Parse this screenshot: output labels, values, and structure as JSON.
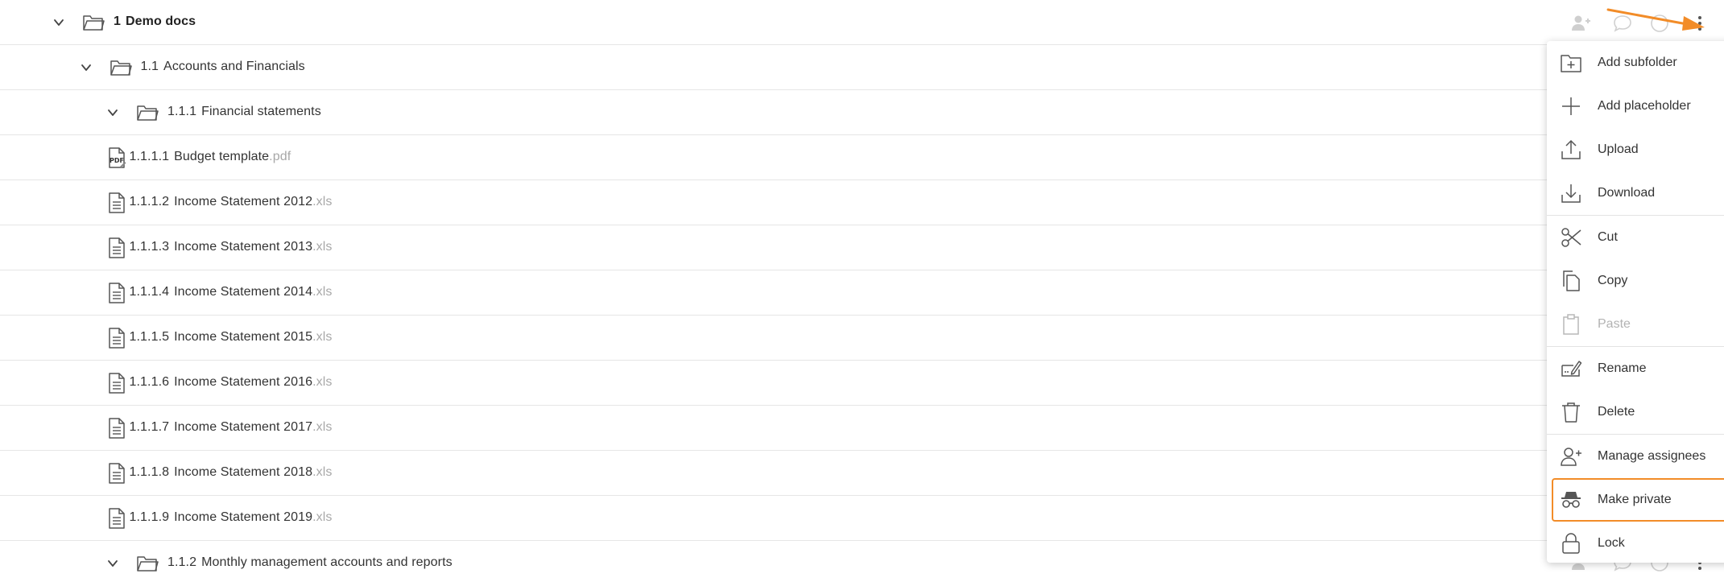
{
  "tree": {
    "rows": [
      {
        "num": "1",
        "name": "Demo docs",
        "ext": "",
        "kind": "folder",
        "bold": true
      },
      {
        "num": "1.1",
        "name": "Accounts and Financials",
        "ext": "",
        "kind": "folder"
      },
      {
        "num": "1.1.1",
        "name": "Financial statements",
        "ext": "",
        "kind": "folder"
      },
      {
        "num": "1.1.1.1",
        "name": "Budget template",
        "ext": ".pdf",
        "kind": "pdf"
      },
      {
        "num": "1.1.1.2",
        "name": "Income Statement 2012",
        "ext": ".xls",
        "kind": "file"
      },
      {
        "num": "1.1.1.3",
        "name": "Income Statement 2013",
        "ext": ".xls",
        "kind": "file"
      },
      {
        "num": "1.1.1.4",
        "name": "Income Statement 2014",
        "ext": ".xls",
        "kind": "file"
      },
      {
        "num": "1.1.1.5",
        "name": "Income Statement 2015",
        "ext": ".xls",
        "kind": "file"
      },
      {
        "num": "1.1.1.6",
        "name": "Income Statement 2016",
        "ext": ".xls",
        "kind": "file"
      },
      {
        "num": "1.1.1.7",
        "name": "Income Statement 2017",
        "ext": ".xls",
        "kind": "file"
      },
      {
        "num": "1.1.1.8",
        "name": "Income Statement 2018",
        "ext": ".xls",
        "kind": "file"
      },
      {
        "num": "1.1.1.9",
        "name": "Income Statement 2019",
        "ext": ".xls",
        "kind": "file"
      },
      {
        "num": "1.1.2",
        "name": "Monthly management accounts and reports",
        "ext": "",
        "kind": "folder"
      }
    ]
  },
  "row_actions": {
    "icons": [
      "add-assignee-icon",
      "comment-icon",
      "status-circle-icon",
      "more-vertical-icon"
    ]
  },
  "context_menu": {
    "groups": [
      [
        {
          "label": "Add subfolder",
          "icon": "add-subfolder-icon"
        },
        {
          "label": "Add placeholder",
          "icon": "plus-icon"
        },
        {
          "label": "Upload",
          "icon": "upload-icon"
        },
        {
          "label": "Download",
          "icon": "download-icon"
        }
      ],
      [
        {
          "label": "Cut",
          "icon": "scissors-icon"
        },
        {
          "label": "Copy",
          "icon": "copy-icon"
        },
        {
          "label": "Paste",
          "icon": "clipboard-icon",
          "disabled": true
        }
      ],
      [
        {
          "label": "Rename",
          "icon": "rename-icon"
        },
        {
          "label": "Delete",
          "icon": "trash-icon"
        }
      ],
      [
        {
          "label": "Manage assignees",
          "icon": "manage-assignees-icon"
        },
        {
          "label": "Make private",
          "icon": "incognito-icon",
          "highlighted": true
        },
        {
          "label": "Lock",
          "icon": "lock-icon"
        }
      ]
    ]
  },
  "colors": {
    "highlight": "#f28c28",
    "arrow": "#f28c28",
    "extension": "#a8a8a8",
    "divider": "#e6e6e6"
  }
}
